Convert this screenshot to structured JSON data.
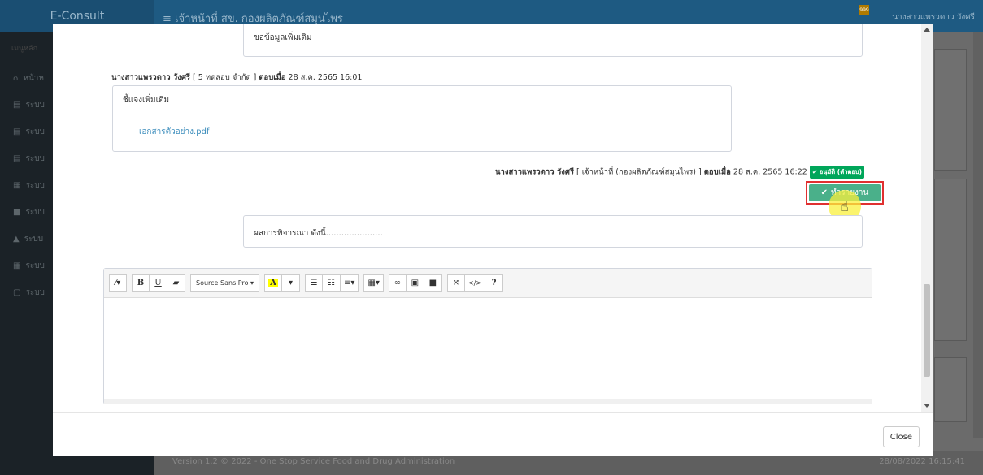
{
  "background": {
    "brand": "E-Consult",
    "header_title": "≡  เจ้าหน้าที่ สข. กองผลิตภัณฑ์สมุนไพร",
    "user_name": "นางสาวแพรวดาว วังศรี",
    "notification_count": "999",
    "sidebar_search": "เมนูหลัก",
    "sidebar_items": [
      "หน้าห",
      "ระบบ",
      "ระบบ",
      "ระบบ",
      "ระบบ",
      "ระบบ",
      "ระบบ",
      "ระบบ",
      "ระบบ"
    ],
    "footer_left": "Version 1.2 © 2022 - One Stop Service Food and Drug Administration",
    "footer_right": "28/08/2022 16:15:41"
  },
  "thread": {
    "request_text": "ขอข้อมูลเพิ่มเติม",
    "reply1": {
      "author": "นางสาวแพรวดาว วังศรี",
      "org": " [ 5 ทดสอบ จำกัด ] ",
      "replied_label": "ตอบเมื่อ",
      "datetime": " 28 ส.ค. 2565 16:01",
      "text": "ชี้แจงเพิ่มเติม",
      "attachment": "เอกสารตัวอย่าง.pdf"
    },
    "reply2": {
      "author": "นางสาวแพรวดาว วังศรี",
      "org": " [ เจ้าหน้าที่ (กองผลิตภัณฑ์สมุนไพร) ] ",
      "replied_label": "ตอบเมื่อ",
      "datetime": " 28 ส.ค. 2565 16:22 ",
      "badge": "✔ อนุมัติ (คำตอบ)",
      "text": "ผลการพิจารณา ดังนี้......................"
    },
    "report_button": "ทำรายงาน"
  },
  "editor": {
    "font_name": "Source Sans Pro ▾",
    "tools": [
      "magic-wand",
      "bold",
      "underline",
      "eraser",
      "font",
      "text-color",
      "color-dropdown",
      "unordered-list",
      "ordered-list",
      "paragraph",
      "table",
      "link",
      "picture",
      "video",
      "fullscreen",
      "code-view",
      "help"
    ]
  },
  "modal": {
    "close_label": "Close"
  },
  "colors": {
    "accent_green": "#4ab08a",
    "badge_green": "#00a65a",
    "link_blue": "#3c8dbc",
    "highlight_red": "#e03030"
  }
}
